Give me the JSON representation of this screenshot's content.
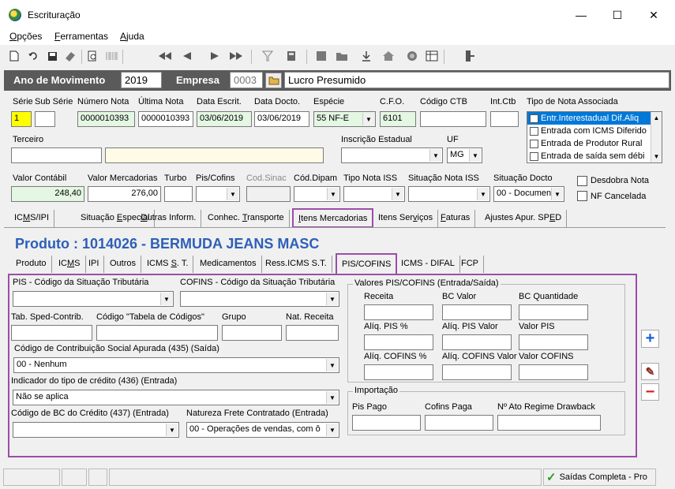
{
  "window": {
    "title": "Escrituração",
    "min": "—",
    "max": "☐",
    "close": "✕"
  },
  "menu": [
    {
      "pre": "",
      "u": "O",
      "post": "pções"
    },
    {
      "pre": "",
      "u": "F",
      "post": "erramentas"
    },
    {
      "pre": "",
      "u": "A",
      "post": "juda"
    }
  ],
  "header": {
    "ano_label": "Ano de Movimento",
    "ano_value": "2019",
    "empresa_label": "Empresa",
    "empresa_code": "0003",
    "empresa_name": "Lucro Presumido"
  },
  "nota": {
    "labels": {
      "serie": "Série",
      "sub_serie": "Sub Série",
      "numero": "Número Nota",
      "ultima": "Última Nota",
      "data_escrit": "Data Escrit.",
      "data_docto": "Data Docto.",
      "especie": "Espécie",
      "cfo": "C.F.O.",
      "codigo_ctb": "Código CTB",
      "int_ctb": "Int.Ctb",
      "tipo_nota": "Tipo de Nota Associada",
      "terceiro": "Terceiro",
      "insc_estadual": "Inscrição Estadual",
      "uf": "UF",
      "valor_contabil": "Valor Contábil",
      "valor_merc": "Valor Mercadorias",
      "turbo": "Turbo",
      "pis_cofins": "Pis/Cofins",
      "cod_sinac": "Cod.Sinac",
      "cod_dipam": "Cód.Dipam",
      "tipo_iss": "Tipo Nota ISS",
      "sit_iss": "Situação Nota ISS",
      "sit_docto": "Situação Docto",
      "desdobra": "Desdobra Nota",
      "cancelada": "NF Cancelada"
    },
    "serie": "1",
    "numero": "0000010393",
    "ultima": "0000010393",
    "data_escrit": "03/06/2019",
    "data_docto": "03/06/2019",
    "especie": "55   NF-E",
    "cfo": "6101",
    "uf": "MG",
    "valor_contabil": "248,40",
    "valor_merc": "276,00",
    "sit_docto": "00 - Documen"
  },
  "tipo_nota_list": [
    "Entr.Interestadual Dif.Aliq",
    "Entrada com ICMS Diferido",
    "Entrada de Produtor Rural",
    "Entrada de saída sem débi"
  ],
  "main_tabs": [
    {
      "pre": "IC",
      "u": "M",
      "post": "S/IPI"
    },
    {
      "pre": "Situação ",
      "u": "E",
      "post": "special"
    },
    {
      "pre": "",
      "u": "O",
      "post": "utras Inform."
    },
    {
      "pre": "Conhec. ",
      "u": "T",
      "post": "ransporte"
    },
    {
      "pre": "",
      "u": "I",
      "post": "tens Mercadorias"
    },
    {
      "pre": "Itens Ser",
      "u": "v",
      "post": "iços"
    },
    {
      "pre": "",
      "u": "F",
      "post": "aturas"
    },
    {
      "pre": "Ajustes Apur. SP",
      "u": "E",
      "post": "D"
    }
  ],
  "produto_title": "Produto : 1014026 - BERMUDA JEANS MASC",
  "sub_tabs": [
    {
      "pre": "Produto",
      "u": "",
      "post": ""
    },
    {
      "pre": "IC",
      "u": "M",
      "post": "S"
    },
    {
      "pre": "IPI",
      "u": "",
      "post": ""
    },
    {
      "pre": "Outros",
      "u": "",
      "post": ""
    },
    {
      "pre": "ICMS ",
      "u": "S",
      "post": ". T."
    },
    {
      "pre": "Medicamentos",
      "u": "",
      "post": ""
    },
    {
      "pre": "Ress.ICMS S.T.",
      "u": "",
      "post": ""
    },
    {
      "pre": "PIS/COFINS",
      "u": "",
      "post": ""
    },
    {
      "pre": "ICMS - DIFAL",
      "u": "",
      "post": ""
    },
    {
      "pre": "FCP",
      "u": "",
      "post": ""
    }
  ],
  "pis": {
    "cst_pis": "PIS - Código da Situação Tributária",
    "cst_cofins": "COFINS - Código da Situação Tributária",
    "tab_sped": "Tab. Sped-Contrib.",
    "cod_tabela": "Código \"Tabela de Códigos\"",
    "grupo": "Grupo",
    "nat_receita": "Nat. Receita",
    "cod_contrib": "Código de Contribuição Social Apurada (435)    (Saída)",
    "cod_contrib_value": "00 - Nenhum",
    "ind_credito": "Indicador do tipo de crédito (436)   (Entrada)",
    "ind_credito_value": "Não se aplica",
    "cod_bc": "Código de BC do Crédito (437) (Entrada)",
    "nat_frete": "Natureza Frete Contratado   (Entrada)",
    "nat_frete_value": "00 - Operações de vendas, com ô",
    "valores_group": "Valores PIS/COFINS   (Entrada/Saída)",
    "receita": "Receita",
    "bc_valor": "BC Valor",
    "bc_qtd": "BC Quantidade",
    "aliq_pis": "Alíq. PIS %",
    "aliq_pis_valor": "Alíq. PIS Valor",
    "valor_pis": "Valor PIS",
    "aliq_cofins": "Alíq. COFINS %",
    "aliq_cofins_valor": "Alíq. COFINS Valor",
    "valor_cofins": "Valor COFINS",
    "importacao_group": "Importação",
    "pis_pago": "Pis Pago",
    "cofins_paga": "Cofins Paga",
    "ato_drawback": "Nº Ato Regime Drawback"
  },
  "side_buttons": {
    "add": "+",
    "edit": "✎",
    "remove": "−"
  },
  "status": {
    "text": "Saídas Completa - Pro"
  },
  "colors": {
    "accent_purple": "#9b4ea8",
    "title_blue": "#2d5fb8",
    "header_gray": "#5a5a5a",
    "add_blue": "#1560d6",
    "remove_red": "#d0201c"
  }
}
